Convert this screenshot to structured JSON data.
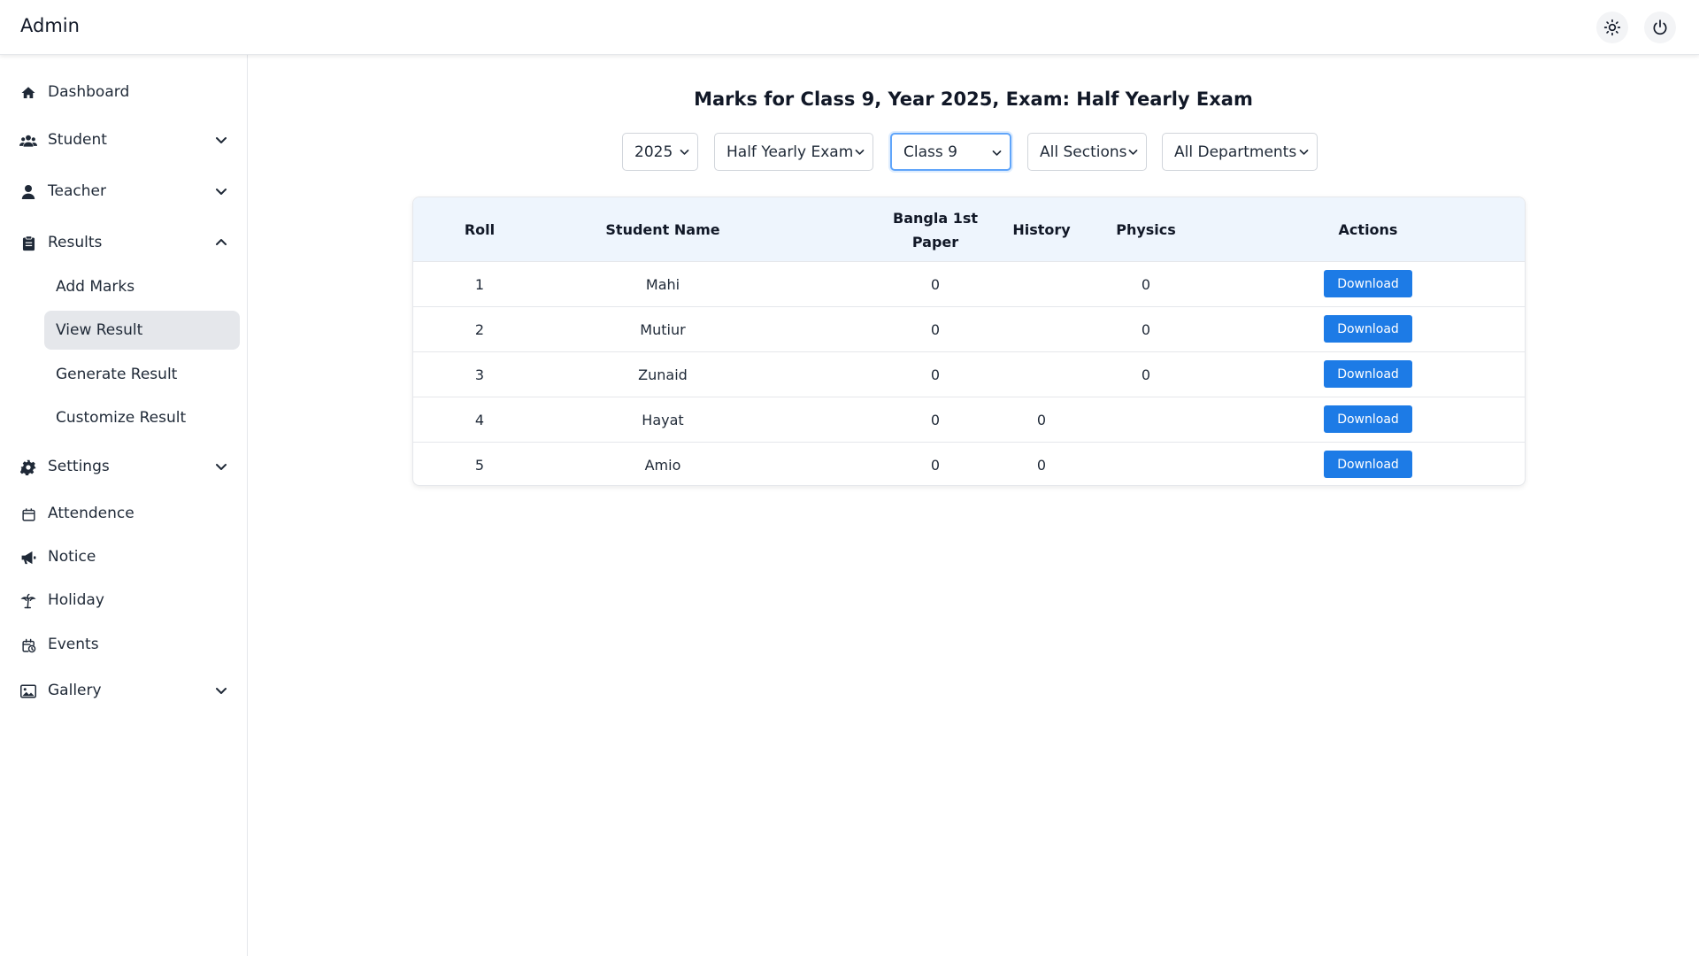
{
  "app": {
    "title": "Admin"
  },
  "header": {
    "theme_icon": "sun-icon",
    "power_icon": "power-icon"
  },
  "sidebar": {
    "items": [
      {
        "label": "Dashboard",
        "icon": "home-icon"
      },
      {
        "label": "Student",
        "icon": "users-icon",
        "expandable": true
      },
      {
        "label": "Teacher",
        "icon": "user-icon",
        "expandable": true
      },
      {
        "label": "Results",
        "icon": "clipboard-icon",
        "expandable": true,
        "expanded": true
      },
      {
        "label": "Settings",
        "icon": "gear-icon",
        "expandable": true
      },
      {
        "label": "Attendence",
        "icon": "calendar-icon"
      },
      {
        "label": "Notice",
        "icon": "megaphone-icon"
      },
      {
        "label": "Holiday",
        "icon": "palm-tree-icon"
      },
      {
        "label": "Events",
        "icon": "calendar-clock-icon"
      },
      {
        "label": "Gallery",
        "icon": "image-icon",
        "expandable": true
      }
    ],
    "results_sub": [
      {
        "label": "Add Marks"
      },
      {
        "label": "View Result",
        "active": true
      },
      {
        "label": "Generate Result"
      },
      {
        "label": "Customize Result"
      }
    ]
  },
  "main": {
    "title": "Marks for Class 9, Year 2025, Exam: Half Yearly Exam",
    "filters": {
      "year": "2025",
      "exam": "Half Yearly Exam",
      "class": "Class 9",
      "section": "All Sections",
      "department": "All Departments"
    },
    "table": {
      "headers": {
        "roll": "Roll",
        "name": "Student Name",
        "bangla_line1": "Bangla 1st",
        "bangla_line2": "Paper",
        "history": "History",
        "physics": "Physics",
        "actions": "Actions"
      },
      "download_label": "Download",
      "rows": [
        {
          "roll": "1",
          "name": "Mahi",
          "bangla": "0",
          "history": "",
          "physics": "0"
        },
        {
          "roll": "2",
          "name": "Mutiur",
          "bangla": "0",
          "history": "",
          "physics": "0"
        },
        {
          "roll": "3",
          "name": "Zunaid",
          "bangla": "0",
          "history": "",
          "physics": "0"
        },
        {
          "roll": "4",
          "name": "Hayat",
          "bangla": "0",
          "history": "0",
          "physics": ""
        },
        {
          "roll": "5",
          "name": "Amio",
          "bangla": "0",
          "history": "0",
          "physics": ""
        }
      ]
    }
  }
}
